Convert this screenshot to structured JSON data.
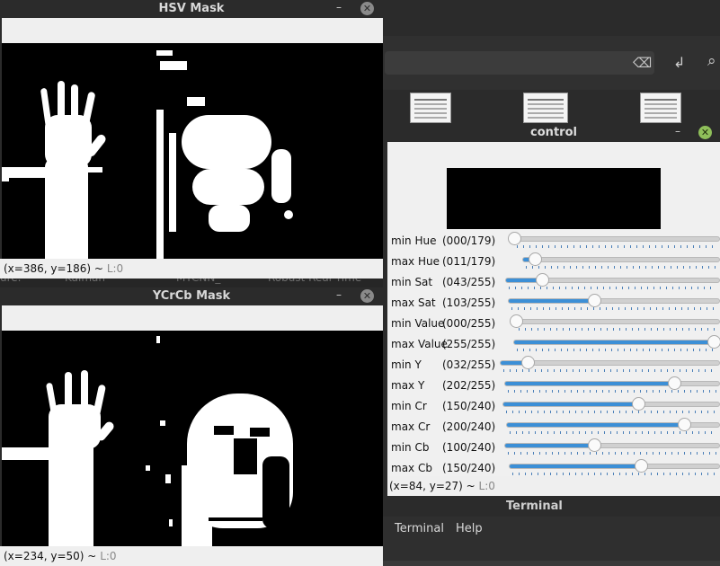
{
  "hsv_window": {
    "title": "HSV Mask",
    "status": "(x=386, y=186) ~",
    "status_level": "L:0"
  },
  "ycrcb_window": {
    "title": "YCrCb Mask",
    "status": "(x=234, y=50) ~",
    "status_level": "L:0"
  },
  "control_window": {
    "title": "control",
    "status": "(x=84, y=27) ~",
    "status_level": "L:0",
    "sliders": [
      {
        "label": "min Hue",
        "value": "(000/179)",
        "fraction": 0.0
      },
      {
        "label": "max Hue",
        "value": "(011/179)",
        "fraction": 0.061
      },
      {
        "label": "min Sat",
        "value": "(043/255)",
        "fraction": 0.169
      },
      {
        "label": "max Sat",
        "value": "(103/255)",
        "fraction": 0.404
      },
      {
        "label": "min Value",
        "value": "(000/255)",
        "fraction": 0.0
      },
      {
        "label": "max Value",
        "value": "(255/255)",
        "fraction": 1.0
      },
      {
        "label": "min Y",
        "value": "(032/255)",
        "fraction": 0.125
      },
      {
        "label": "max Y",
        "value": "(202/255)",
        "fraction": 0.792
      },
      {
        "label": "min Cr",
        "value": "(150/240)",
        "fraction": 0.625
      },
      {
        "label": "max Cr",
        "value": "(200/240)",
        "fraction": 0.833
      },
      {
        "label": "min Cb",
        "value": "(100/240)",
        "fraction": 0.417
      },
      {
        "label": "max Cb",
        "value": "(150/240)",
        "fraction": 0.625
      }
    ]
  },
  "background": {
    "files": [
      "ure.",
      "Kalman",
      "MTCNN_",
      "Robust Real Time"
    ],
    "terminal_title": "Terminal",
    "menu": [
      "Terminal",
      "Help"
    ]
  },
  "colors": {
    "slider_fill": "#3c8fd6",
    "close_button_active": "#8fbf5a"
  }
}
